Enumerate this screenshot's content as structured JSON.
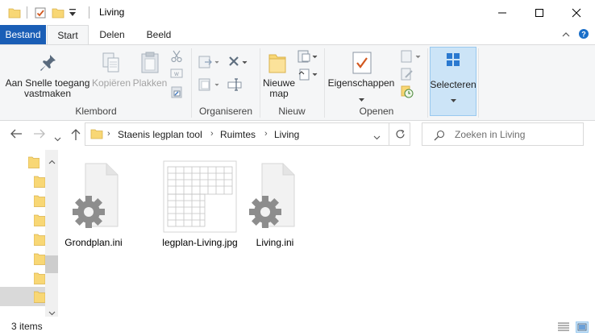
{
  "window": {
    "title": "Living",
    "controls": {
      "minimize": "—",
      "maximize": "☐",
      "close": "✕"
    }
  },
  "ribbon_tabs": [
    "Bestand",
    "Start",
    "Delen",
    "Beeld"
  ],
  "ribbon": {
    "klembord": {
      "pin_label_line1": "Aan Snelle toegang",
      "pin_label_line2": "vastmaken",
      "copy_label": "Kopiëren",
      "paste_label": "Plakken",
      "group_label": "Klembord"
    },
    "organiseren": {
      "group_label": "Organiseren"
    },
    "nieuw": {
      "new_folder_line1": "Nieuwe",
      "new_folder_line2": "map",
      "group_label": "Nieuw"
    },
    "openen": {
      "properties_label": "Eigenschappen",
      "group_label": "Openen"
    },
    "selecteren": {
      "label": "Selecteren"
    }
  },
  "address": {
    "breadcrumbs": [
      "Staenis legplan tool",
      "Ruimtes",
      "Living"
    ],
    "separator": "›"
  },
  "search": {
    "placeholder": "Zoeken in Living"
  },
  "files": [
    {
      "name": "Grondplan.ini",
      "type": "ini"
    },
    {
      "name": "legplan-Living.jpg",
      "type": "jpg"
    },
    {
      "name": "Living.ini",
      "type": "ini"
    }
  ],
  "status": {
    "item_count": "3 items"
  },
  "colors": {
    "file_tab": "#1a5eb6",
    "folder": "#f8d775",
    "selected": "#cce4f7"
  }
}
